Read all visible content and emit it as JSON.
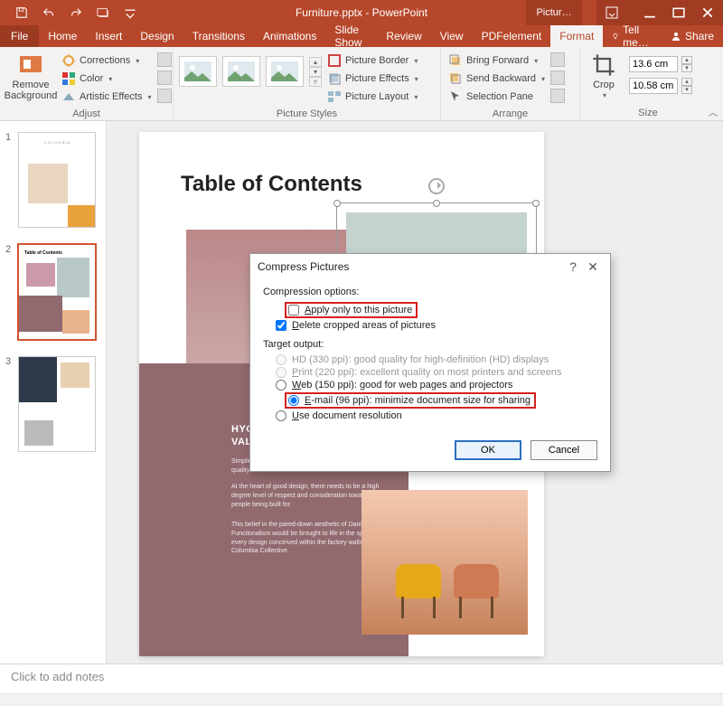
{
  "titlebar": {
    "title": "Furniture.pptx - PowerPoint",
    "contextual_label": "Pictur…"
  },
  "menubar": {
    "tabs": [
      "File",
      "Home",
      "Insert",
      "Design",
      "Transitions",
      "Animations",
      "Slide Show",
      "Review",
      "View",
      "PDFelement",
      "Format"
    ],
    "active_index": 10,
    "tell_me": "Tell me…",
    "share": "Share"
  },
  "ribbon": {
    "adjust": {
      "remove_bg": "Remove Background",
      "corrections": "Corrections",
      "color": "Color",
      "artistic": "Artistic Effects",
      "group_label": "Adjust"
    },
    "styles": {
      "border": "Picture Border",
      "effects": "Picture Effects",
      "layout": "Picture Layout",
      "group_label": "Picture Styles"
    },
    "arrange": {
      "forward": "Bring Forward",
      "backward": "Send Backward",
      "selpane": "Selection Pane",
      "group_label": "Arrange"
    },
    "size": {
      "crop": "Crop",
      "height": "13.6 cm",
      "width": "10.58 cm",
      "group_label": "Size"
    }
  },
  "slide": {
    "heading": "Table of Contents",
    "section_title": "HYGGE-CENTRIC DESIGN VALUES",
    "para1": "Simplicity, craftsmanship, elegant functionality and quality materials.",
    "para2": "At the heart of good design, there needs to be a high degree level of respect and consideration toward the people being built for.",
    "para3": "This belief in the pared-down aesthetic of Danish Functionalism would be brought to life in the spirit of every design conceived within the factory walls of the Columbia Collective."
  },
  "dialog": {
    "title": "Compress Pictures",
    "compression_label": "Compression options:",
    "apply_only": "Apply only to this picture",
    "delete_cropped": "Delete cropped areas of pictures",
    "target_label": "Target output:",
    "opt_hd": "HD (330 ppi): good quality for high-definition (HD) displays",
    "opt_print": "Print (220 ppi): excellent quality on most printers and screens",
    "opt_web": "Web (150 ppi): good for web pages and projectors",
    "opt_email": "E-mail (96 ppi): minimize document size for sharing",
    "opt_docres": "Use document resolution",
    "ok": "OK",
    "cancel": "Cancel"
  },
  "notes": {
    "placeholder": "Click to add notes"
  },
  "thumbnails": [
    "1",
    "2",
    "3"
  ]
}
